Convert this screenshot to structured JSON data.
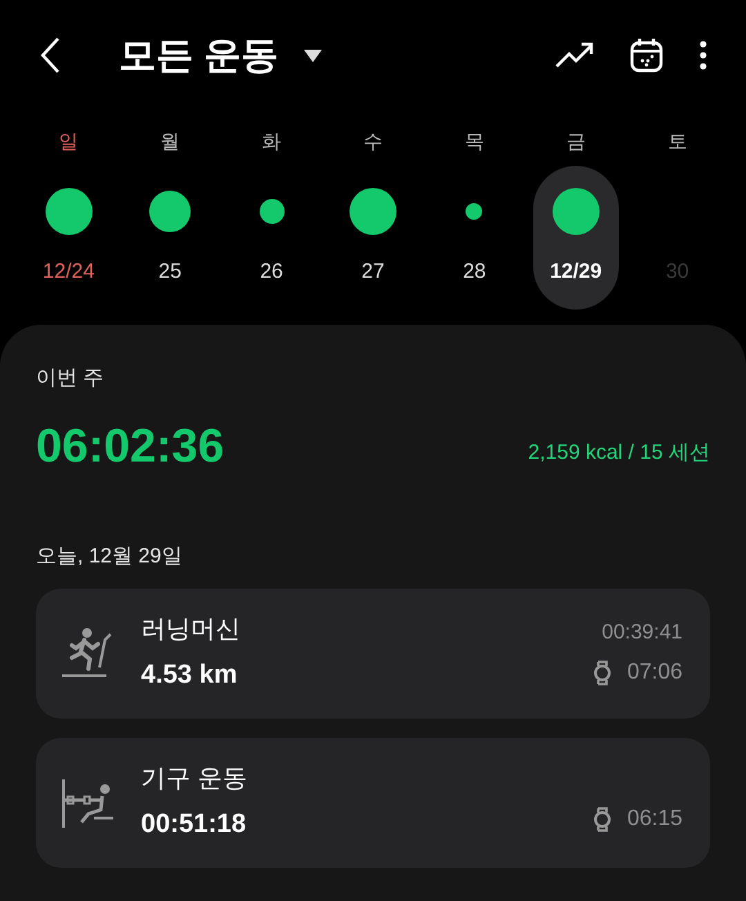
{
  "header": {
    "title": "모든 운동"
  },
  "days": [
    {
      "weekday": "일",
      "date": "12/24",
      "kind": "large",
      "holiday": true,
      "selected": false,
      "disabled": false
    },
    {
      "weekday": "월",
      "date": "25",
      "kind": "medium",
      "holiday": false,
      "selected": false,
      "disabled": false
    },
    {
      "weekday": "화",
      "date": "26",
      "kind": "small",
      "holiday": false,
      "selected": false,
      "disabled": false
    },
    {
      "weekday": "수",
      "date": "27",
      "kind": "large",
      "holiday": false,
      "selected": false,
      "disabled": false
    },
    {
      "weekday": "목",
      "date": "28",
      "kind": "tiny",
      "holiday": false,
      "selected": false,
      "disabled": false
    },
    {
      "weekday": "금",
      "date": "12/29",
      "kind": "large",
      "holiday": false,
      "selected": true,
      "disabled": false
    },
    {
      "weekday": "토",
      "date": "30",
      "kind": "empty",
      "holiday": false,
      "selected": false,
      "disabled": true
    }
  ],
  "week": {
    "label": "이번 주",
    "total_time": "06:02:36",
    "summary": "2,159 kcal / 15 세션"
  },
  "today_label": "오늘, 12월 29일",
  "workouts": [
    {
      "kind": "treadmill",
      "name": "러닝머신",
      "value": "4.53 km",
      "duration": "00:39:41",
      "watch_time": "07:06"
    },
    {
      "kind": "machine",
      "name": "기구 운동",
      "value": "00:51:18",
      "watch_time": "06:15"
    }
  ]
}
